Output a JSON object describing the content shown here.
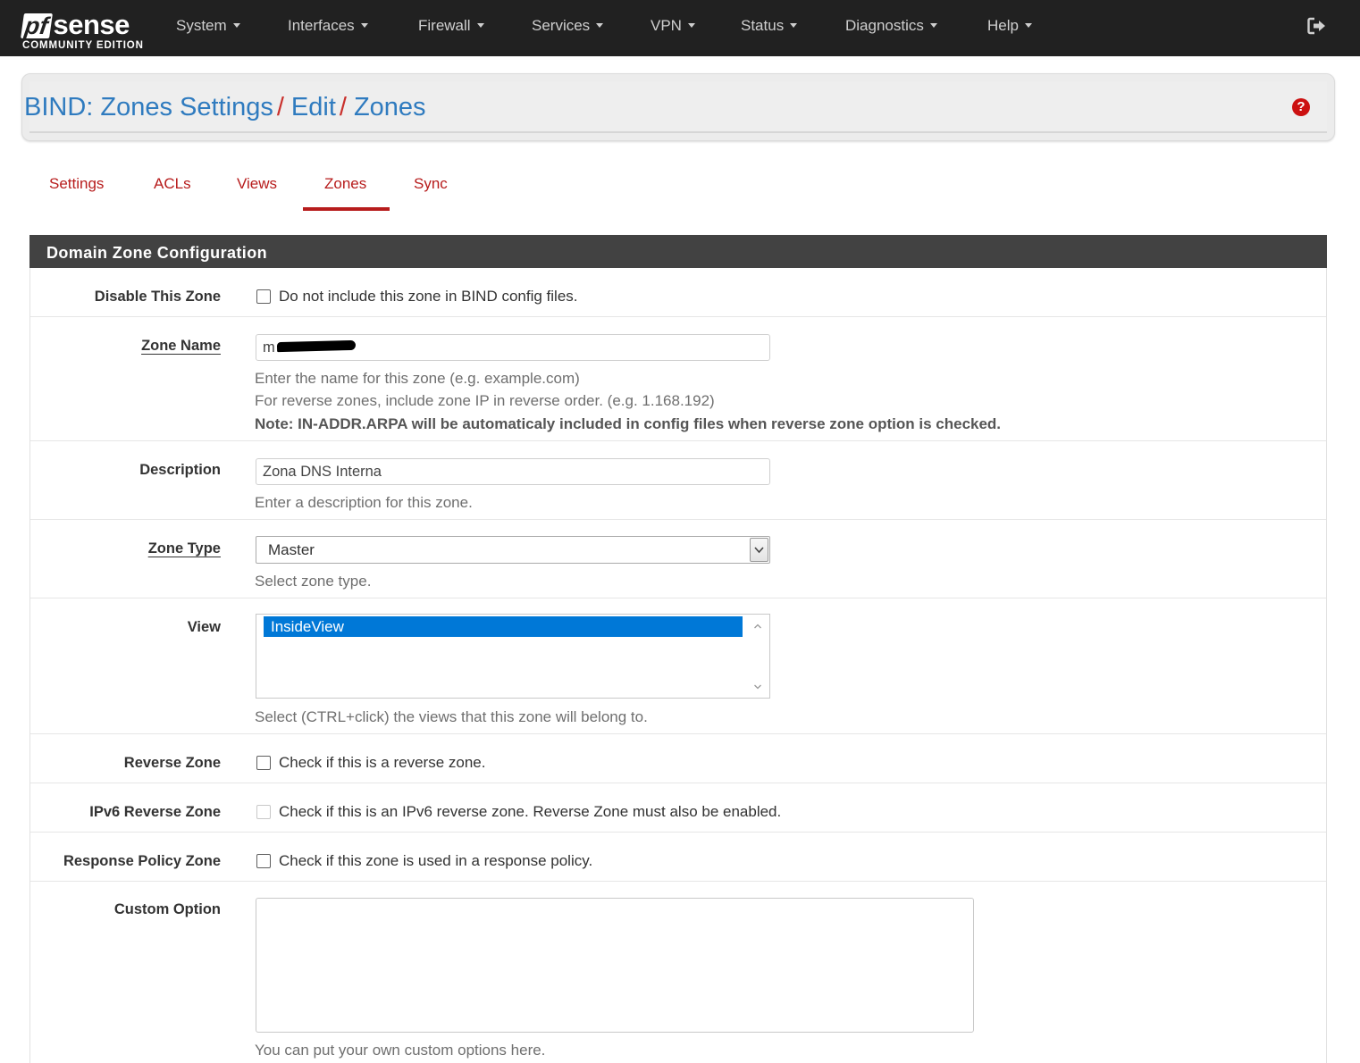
{
  "brand": {
    "pf": "pf",
    "sense": "sense",
    "edition": "COMMUNITY EDITION"
  },
  "nav": {
    "items": [
      {
        "label": "System"
      },
      {
        "label": "Interfaces"
      },
      {
        "label": "Firewall"
      },
      {
        "label": "Services"
      },
      {
        "label": "VPN"
      },
      {
        "label": "Status"
      },
      {
        "label": "Diagnostics"
      },
      {
        "label": "Help"
      }
    ],
    "logout_icon": "sign-out-icon"
  },
  "breadcrumb": {
    "items": [
      "BIND: Zones Settings",
      "Edit",
      "Zones"
    ],
    "separator": "/",
    "help_icon": "question-circle-icon",
    "help_glyph": "?"
  },
  "tabs": [
    {
      "label": "Settings",
      "active": false
    },
    {
      "label": "ACLs",
      "active": false
    },
    {
      "label": "Views",
      "active": false
    },
    {
      "label": "Zones",
      "active": true
    },
    {
      "label": "Sync",
      "active": false
    }
  ],
  "panel": {
    "title": "Domain Zone Configuration",
    "fields": {
      "disable_zone": {
        "label": "Disable This Zone",
        "checked": false,
        "text": "Do not include this zone in BIND config files."
      },
      "zone_name": {
        "label": "Zone Name",
        "value": "m",
        "help1": "Enter the name for this zone (e.g. example.com)",
        "help2": "For reverse zones, include zone IP in reverse order. (e.g. 1.168.192)",
        "help3": "Note: IN-ADDR.ARPA will be automaticaly included in config files when reverse zone option is checked."
      },
      "description": {
        "label": "Description",
        "value": "Zona DNS Interna",
        "help": "Enter a description for this zone."
      },
      "zone_type": {
        "label": "Zone Type",
        "value": "Master",
        "help": "Select zone type."
      },
      "view": {
        "label": "View",
        "selected": "InsideView",
        "help": "Select (CTRL+click) the views that this zone will belong to."
      },
      "reverse_zone": {
        "label": "Reverse Zone",
        "checked": false,
        "text": "Check if this is a reverse zone."
      },
      "ipv6_reverse_zone": {
        "label": "IPv6 Reverse Zone",
        "checked": false,
        "disabled": true,
        "text": "Check if this is an IPv6 reverse zone. Reverse Zone must also be enabled."
      },
      "response_policy_zone": {
        "label": "Response Policy Zone",
        "checked": false,
        "text": "Check if this zone is used in a response policy."
      },
      "custom_option": {
        "label": "Custom Option",
        "value": "",
        "help": "You can put your own custom options here."
      }
    }
  },
  "colors": {
    "navbar": "#212121",
    "link": "#2f7bbf",
    "accent": "#b71c1c",
    "panel_head": "#424242",
    "selection": "#0078d7"
  }
}
